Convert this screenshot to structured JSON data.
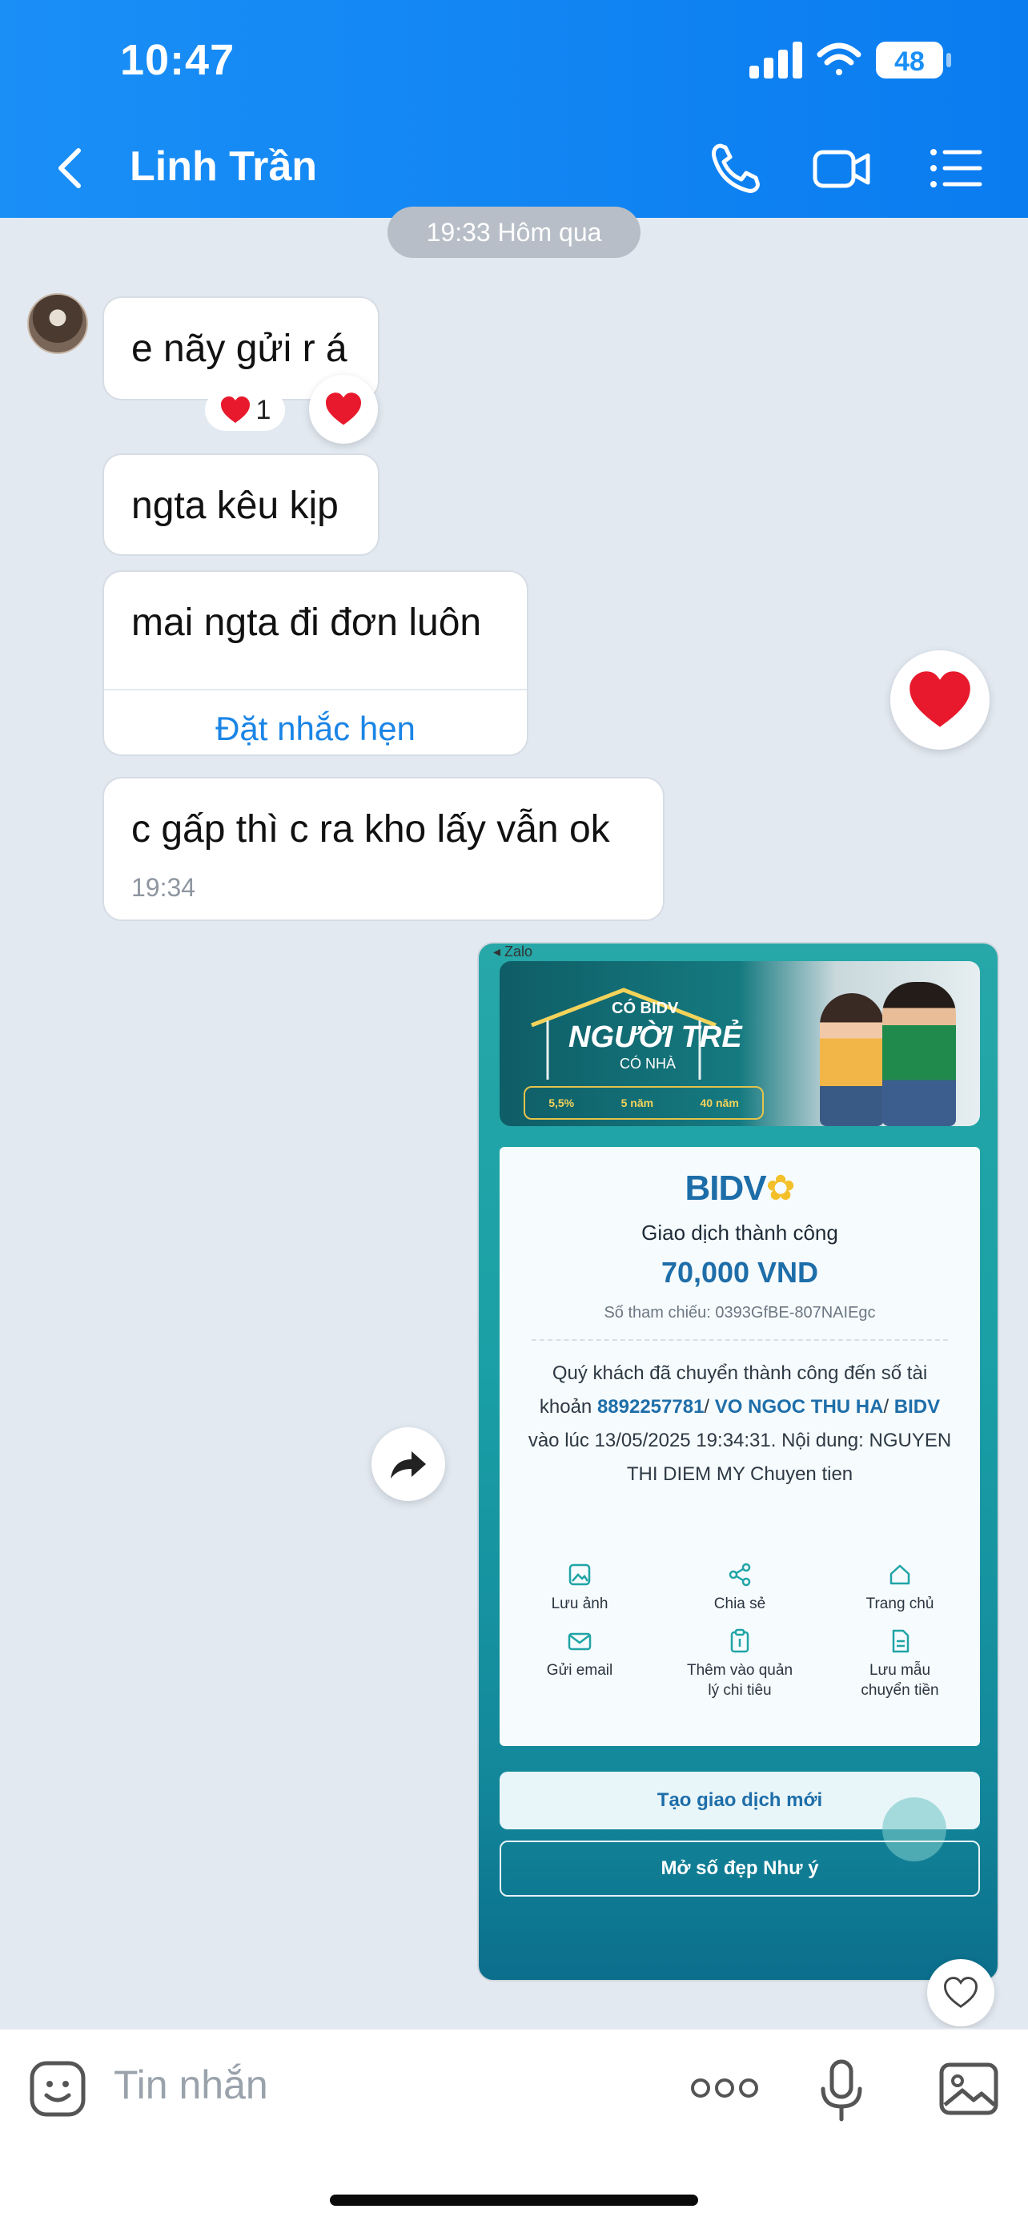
{
  "status_bar": {
    "time": "10:47",
    "battery": "48"
  },
  "header": {
    "title": "Linh Trần"
  },
  "timestamp_pill": "19:33 Hôm qua",
  "messages": [
    {
      "text": "e nãy gửi r á",
      "reaction_count": "1"
    },
    {
      "text": "ngta kêu kịp"
    },
    {
      "text": "mai ngta đi đơn luôn",
      "action": "Đặt nhắc hẹn"
    },
    {
      "text": "c gấp thì c ra kho lấy vẫn ok",
      "time": "19:34"
    }
  ],
  "receipt": {
    "source_tag": "◂ Zalo",
    "banner": {
      "line1": "CÓ BIDV",
      "line2": "NGƯỜI TRẺ",
      "line3": "CÓ NHÀ",
      "stat1": "5,5%",
      "stat2": "5 năm",
      "stat3": "40 năm"
    },
    "logo": "BIDV",
    "title": "Giao dịch thành công",
    "amount": "70,000 VND",
    "reference": "Số tham chiếu: 0393GfBE-807NAIEgc",
    "desc_1": "Quý khách đã chuyển thành công đến số tài khoản ",
    "account": "8892257781",
    "sep1": "/ ",
    "recipient": "VO NGOC THU HA",
    "sep2": "/ ",
    "bank": "BIDV",
    "desc_2": " vào lúc 13/05/2025 19:34:31. Nội dung: NGUYEN THI DIEM MY Chuyen tien",
    "actions": [
      {
        "label": "Lưu ảnh",
        "icon": "image-icon"
      },
      {
        "label": "Chia sẻ",
        "icon": "share-icon"
      },
      {
        "label": "Trang chủ",
        "icon": "home-icon"
      },
      {
        "label": "Gửi email",
        "icon": "mail-icon"
      },
      {
        "label": "Thêm vào quản lý chi tiêu",
        "icon": "clipboard-icon"
      },
      {
        "label": "Lưu mẫu chuyển tiền",
        "icon": "document-icon"
      }
    ],
    "btn_new": "Tạo giao dịch mới",
    "btn_pretty": "Mở số đẹp Như ý"
  },
  "input": {
    "placeholder": "Tin nhắn"
  },
  "colors": {
    "header": "#0a7cf0",
    "link": "#1b85e6",
    "bidv_blue": "#1e6ea9",
    "heart": "#e8192c"
  }
}
